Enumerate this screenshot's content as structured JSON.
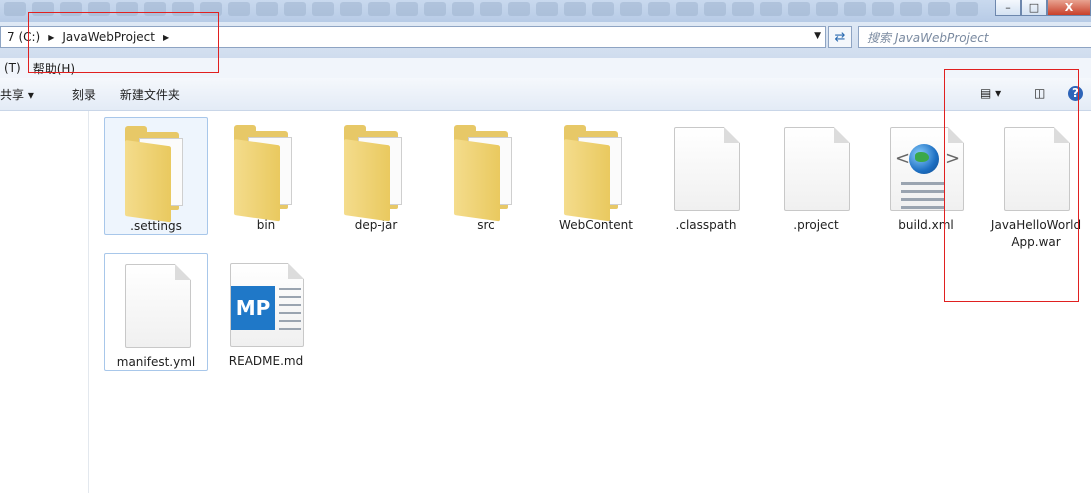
{
  "window": {
    "minimize": "–",
    "maximize": "□",
    "close": "X"
  },
  "address": {
    "segments": [
      "7 (C:)",
      "JavaWebProject"
    ],
    "search_placeholder": "搜索 JavaWebProject"
  },
  "menu": {
    "items": [
      "(T)",
      "帮助(H)"
    ]
  },
  "toolbar": {
    "share": "共享 ▾",
    "burn": "刻录",
    "new_folder": "新建文件夹"
  },
  "files": [
    {
      "name": ".settings",
      "kind": "folder"
    },
    {
      "name": "bin",
      "kind": "folder"
    },
    {
      "name": "dep-jar",
      "kind": "folder"
    },
    {
      "name": "src",
      "kind": "folder"
    },
    {
      "name": "WebContent",
      "kind": "folder"
    },
    {
      "name": ".classpath",
      "kind": "file"
    },
    {
      "name": ".project",
      "kind": "file"
    },
    {
      "name": "build.xml",
      "kind": "xml"
    },
    {
      "name": "JavaHelloWorldApp.war",
      "kind": "file"
    },
    {
      "name": "manifest.yml",
      "kind": "file"
    },
    {
      "name": "README.md",
      "kind": "markdown"
    }
  ],
  "icons": {
    "folder": "folder-icon",
    "file": "file-icon",
    "xml": "xml-globe-icon",
    "markdown": "markdown-icon"
  },
  "badge": {
    "md": "MP"
  },
  "colors": {
    "annotation": "#e02020",
    "accent": "#1f78c8"
  }
}
